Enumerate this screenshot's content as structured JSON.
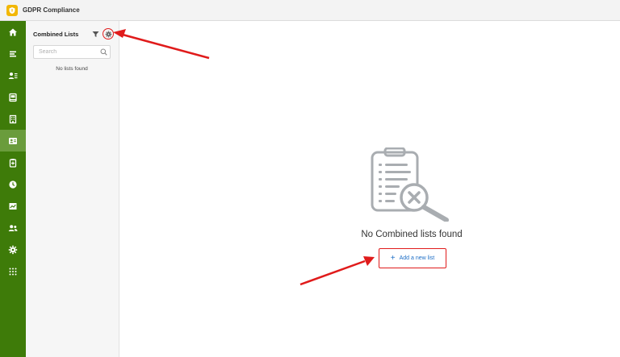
{
  "app": {
    "title": "GDPR Compliance",
    "logo": "shield-icon",
    "accent": "#3e7b09"
  },
  "rail": {
    "items": [
      {
        "icon": "home-icon",
        "active": false
      },
      {
        "icon": "list-icon",
        "active": false
      },
      {
        "icon": "people-list-icon",
        "active": false
      },
      {
        "icon": "inbox-icon",
        "active": false
      },
      {
        "icon": "building-icon",
        "active": false
      },
      {
        "icon": "contact-card-icon",
        "active": true
      },
      {
        "icon": "clipboard-icon",
        "active": false
      },
      {
        "icon": "clock-icon",
        "active": false
      },
      {
        "icon": "chart-icon",
        "active": false
      },
      {
        "icon": "users-icon",
        "active": false
      },
      {
        "icon": "gear-icon",
        "active": false
      },
      {
        "icon": "apps-grid-icon",
        "active": false
      }
    ]
  },
  "panel": {
    "title": "Combined Lists",
    "filter_icon": "filter-icon",
    "settings_icon": "gear-icon",
    "search": {
      "placeholder": "Search",
      "value": ""
    },
    "empty_text": "No lists found"
  },
  "main": {
    "illustration": "clipboard-search-x-icon",
    "empty_title": "No Combined lists found",
    "add_button": {
      "icon": "+",
      "label": "Add a new list"
    }
  },
  "annotations": {
    "color": "#e01b1b"
  }
}
